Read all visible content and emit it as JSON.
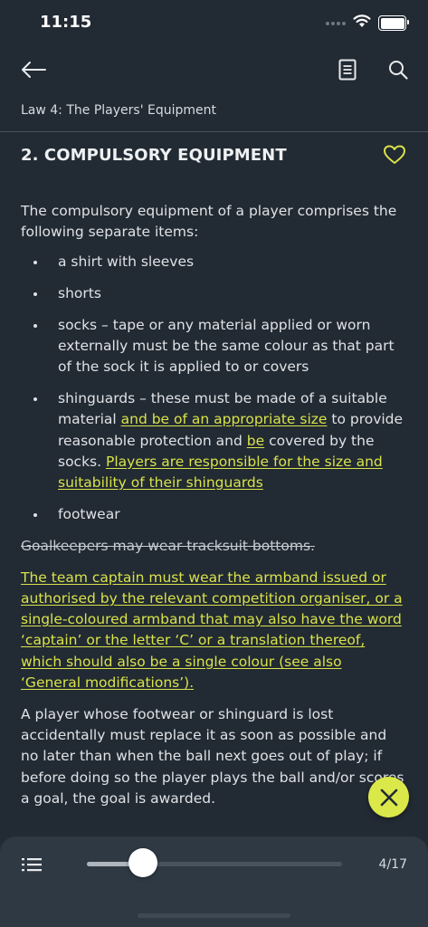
{
  "status_bar": {
    "time": "11:15"
  },
  "breadcrumb": "Law 4: The Players' Equipment",
  "section_title": "2. COMPULSORY EQUIPMENT",
  "intro": "The compulsory equipment of a player comprises the following separate items:",
  "items": {
    "shirt": "a shirt with sleeves",
    "shorts": "shorts",
    "socks": "socks – tape or any material applied or worn externally must be the same colour as that part of the sock it is applied to or covers",
    "shinguards": {
      "p1": "shinguards – these must be made of a suitable material ",
      "h1": "and be of an appropriate size",
      "p2": " to provide reasonable protection and ",
      "h2": "be",
      "p3": " covered by the socks. ",
      "h3": "Players are responsible for the size and suitability of their shinguards"
    },
    "footwear": "footwear"
  },
  "struck_text": "Goalkeepers may wear tracksuit bottoms.",
  "captain_text": "The team captain must wear the armband issued or authorised by the relevant competition organiser, or a single-coloured armband that may also have the word ‘captain’ or the letter ‘C’ or a translation thereof, which should also be a single colour (see also ‘General modifications’).",
  "lost_equipment_text": "A player whose footwear or shinguard is lost accidentally must replace it as soon as possible and no later than when the ball next goes out of play; if before doing so the player plays the ball and/or scores a goal, the goal is awarded.",
  "bottom_bar": {
    "page_counter": "4/17",
    "progress": 0.22
  },
  "colors": {
    "background": "#222a33",
    "highlight": "#d9e34a",
    "fab": "#dbe849",
    "bottom_bar": "#2f3944"
  },
  "icons": [
    "back-arrow-icon",
    "document-icon",
    "search-icon",
    "heart-icon",
    "close-icon",
    "list-icon",
    "wifi-icon",
    "battery-icon"
  ]
}
